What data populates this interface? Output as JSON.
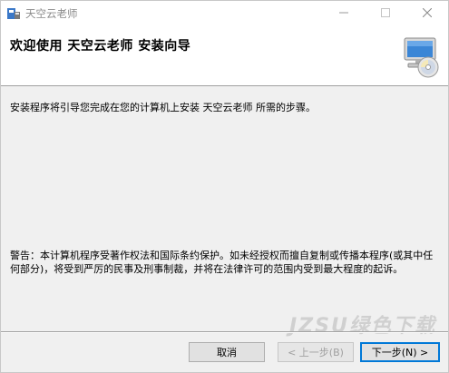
{
  "window": {
    "title": "天空云老师",
    "icons": {
      "app": "installer-app-icon",
      "minimize": "minimize-icon",
      "maximize": "maximize-icon",
      "close": "close-icon"
    }
  },
  "header": {
    "title": "欢迎使用 天空云老师 安装向导",
    "graphic": "computer-cd-icon"
  },
  "body": {
    "intro": "安装程序将引导您完成在您的计算机上安装 天空云老师 所需的步骤。",
    "warning": "警告：本计算机程序受著作权法和国际条约保护。如未经授权而擅自复制或传播本程序(或其中任何部分)，将受到严厉的民事及刑事制裁，并将在法律许可的范围内受到最大程度的起诉。"
  },
  "buttons": {
    "cancel": "取消",
    "back": "< 上一步(B)",
    "next": "下一步(N) >"
  },
  "watermark": "JZSU绿色下载",
  "colors": {
    "accent": "#0078d7",
    "disabled_text": "#a0a0a0"
  }
}
